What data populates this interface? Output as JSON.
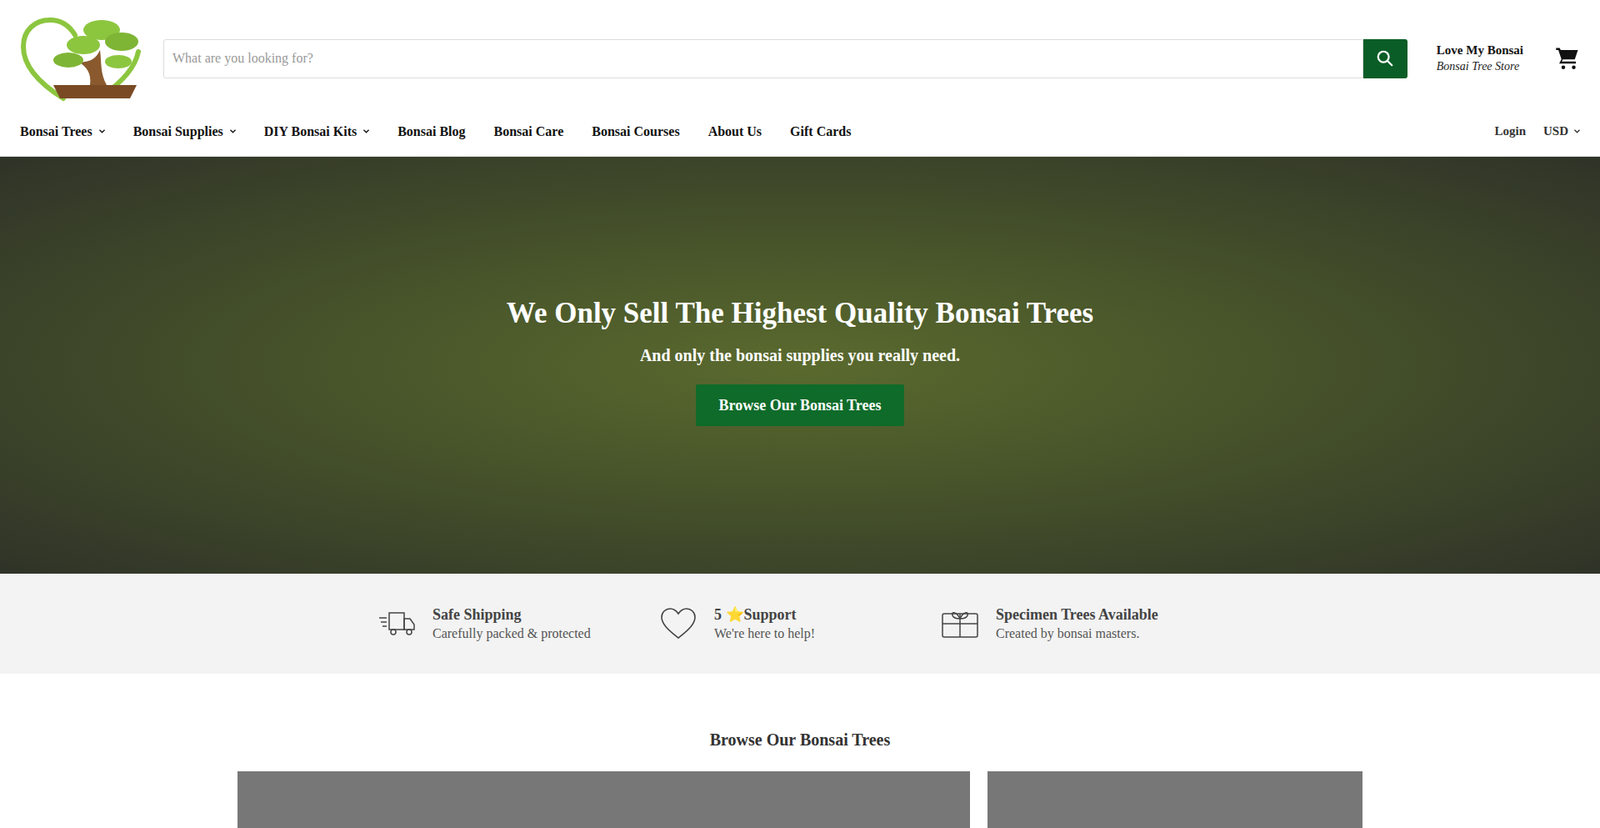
{
  "search": {
    "placeholder": "What are you looking for?"
  },
  "brand": {
    "title": "Love My Bonsai",
    "subtitle": "Bonsai Tree Store"
  },
  "nav": [
    {
      "label": "Bonsai Trees",
      "kind": "dropdown"
    },
    {
      "label": "Bonsai Supplies",
      "kind": "dropdown"
    },
    {
      "label": "DIY Bonsai Kits",
      "kind": "dropdown"
    },
    {
      "label": "Bonsai Blog",
      "kind": "link"
    },
    {
      "label": "Bonsai Care",
      "kind": "link"
    },
    {
      "label": "Bonsai Courses",
      "kind": "link"
    },
    {
      "label": "About Us",
      "kind": "link"
    },
    {
      "label": "Gift Cards",
      "kind": "link"
    }
  ],
  "account": {
    "login": "Login",
    "currency": "USD"
  },
  "hero": {
    "title": "We Only Sell The Highest Quality Bonsai Trees",
    "subtitle": "And only the bonsai supplies you really need.",
    "button": "Browse Our Bonsai Trees"
  },
  "features": [
    {
      "title": "Safe Shipping",
      "subtitle": "Carefully packed & protected",
      "kind": "shipping"
    },
    {
      "title": "5 ⭐Support",
      "subtitle": "We're here to help!",
      "kind": "support"
    },
    {
      "title": "Specimen Trees Available",
      "subtitle": "Created by bonsai masters.",
      "kind": "specimen"
    }
  ],
  "collections": {
    "heading": "Browse Our Bonsai Trees"
  }
}
